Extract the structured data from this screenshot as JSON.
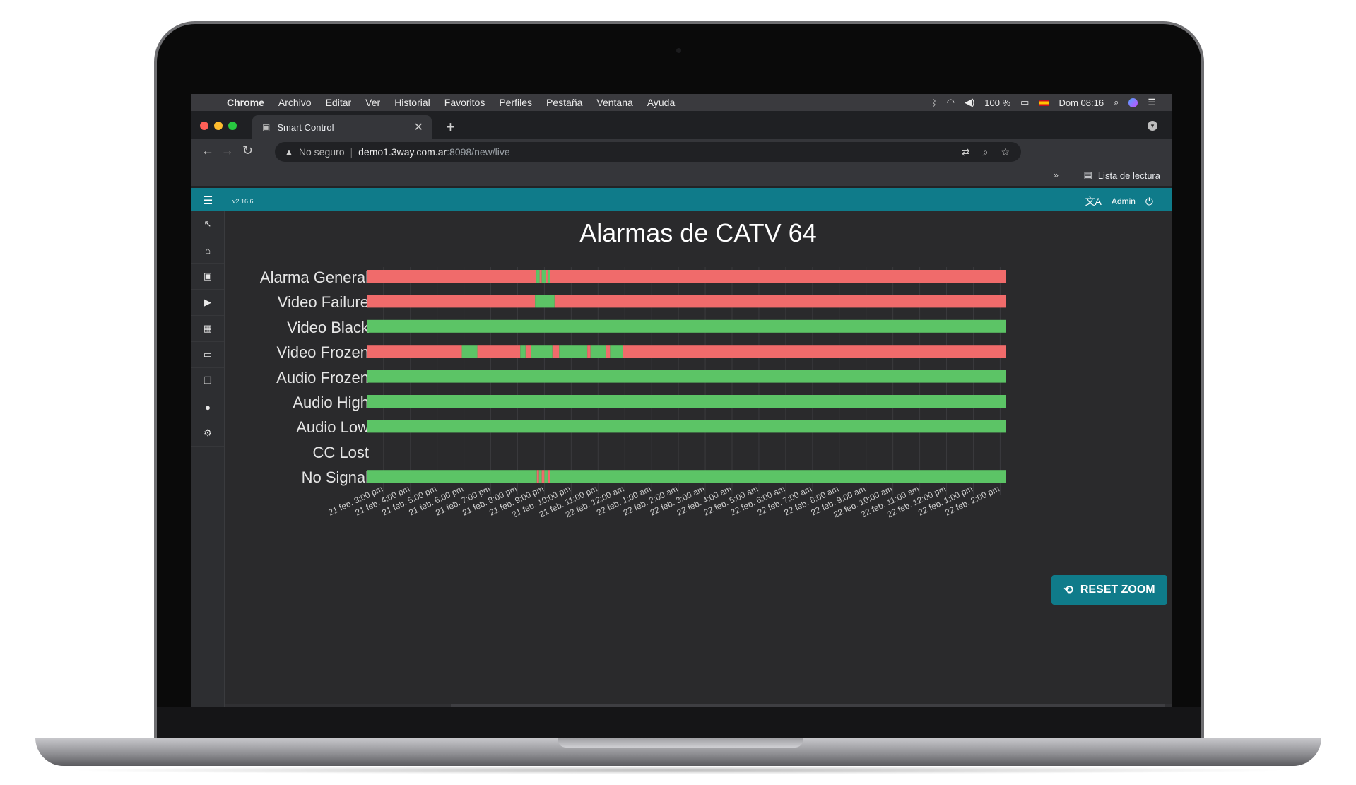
{
  "menubar": {
    "apple_icon": "apple-logo-icon",
    "items": [
      "Chrome",
      "Archivo",
      "Editar",
      "Ver",
      "Historial",
      "Favoritos",
      "Perfiles",
      "Pestaña",
      "Ventana",
      "Ayuda"
    ],
    "battery": "100 %",
    "clock": "Dom 08:16"
  },
  "browser": {
    "tab_title": "Smart Control",
    "url_warning": "No seguro",
    "url_host": "demo1.3way.com.ar",
    "url_path": ":8098/new/live",
    "reading_list": "Lista de lectura",
    "bookmarks_more": "»"
  },
  "app": {
    "version": "v2.16.6",
    "user": "Admin",
    "accent": "#0f7b8a"
  },
  "chart_data": {
    "type": "timeline",
    "title": "Alarmas de CATV 64",
    "colors": {
      "alarm": "#f06b6b",
      "ok": "#5cc466"
    },
    "x_ticks": [
      "21 feb. 3:00 pm",
      "21 feb. 4:00 pm",
      "21 feb. 5:00 pm",
      "21 feb. 6:00 pm",
      "21 feb. 7:00 pm",
      "21 feb. 8:00 pm",
      "21 feb. 9:00 pm",
      "21 feb. 10:00 pm",
      "21 feb. 11:00 pm",
      "22 feb. 12:00 am",
      "22 feb. 1:00 am",
      "22 feb. 2:00 am",
      "22 feb. 3:00 am",
      "22 feb. 4:00 am",
      "22 feb. 5:00 am",
      "22 feb. 6:00 am",
      "22 feb. 7:00 am",
      "22 feb. 8:00 am",
      "22 feb. 9:00 am",
      "22 feb. 10:00 am",
      "22 feb. 11:00 am",
      "22 feb. 12:00 pm",
      "22 feb. 1:00 pm",
      "22 feb. 2:00 pm"
    ],
    "x_range_hours": [
      -0.6,
      23.2
    ],
    "rows": [
      {
        "name": "Alarma General",
        "segments": [
          [
            -0.6,
            5.7,
            "alarm"
          ],
          [
            5.7,
            5.82,
            "ok"
          ],
          [
            5.82,
            5.9,
            "alarm"
          ],
          [
            5.9,
            6.05,
            "ok"
          ],
          [
            6.05,
            6.12,
            "alarm"
          ],
          [
            6.12,
            6.22,
            "ok"
          ],
          [
            6.22,
            23.2,
            "alarm"
          ]
        ]
      },
      {
        "name": "Video Failure",
        "segments": [
          [
            -0.6,
            5.65,
            "alarm"
          ],
          [
            5.65,
            6.38,
            "ok"
          ],
          [
            6.38,
            23.2,
            "alarm"
          ]
        ]
      },
      {
        "name": "Video Black",
        "segments": [
          [
            -0.6,
            23.2,
            "ok"
          ]
        ]
      },
      {
        "name": "Video Frozen",
        "segments": [
          [
            -0.6,
            2.92,
            "alarm"
          ],
          [
            2.92,
            3.5,
            "ok"
          ],
          [
            3.5,
            5.1,
            "alarm"
          ],
          [
            5.1,
            5.3,
            "ok"
          ],
          [
            5.3,
            5.5,
            "alarm"
          ],
          [
            5.5,
            6.3,
            "ok"
          ],
          [
            6.3,
            6.55,
            "alarm"
          ],
          [
            6.55,
            7.6,
            "ok"
          ],
          [
            7.6,
            7.72,
            "alarm"
          ],
          [
            7.72,
            8.3,
            "ok"
          ],
          [
            8.3,
            8.45,
            "alarm"
          ],
          [
            8.45,
            8.93,
            "ok"
          ],
          [
            8.93,
            23.2,
            "alarm"
          ]
        ]
      },
      {
        "name": "Audio Frozen",
        "segments": [
          [
            -0.6,
            23.2,
            "ok"
          ]
        ]
      },
      {
        "name": "Audio High",
        "segments": [
          [
            -0.6,
            23.2,
            "ok"
          ]
        ]
      },
      {
        "name": "Audio Low",
        "segments": [
          [
            -0.6,
            23.2,
            "ok"
          ]
        ]
      },
      {
        "name": "CC Lost",
        "segments": []
      },
      {
        "name": "No Signal",
        "segments": [
          [
            -0.6,
            5.72,
            "ok"
          ],
          [
            5.72,
            5.8,
            "alarm"
          ],
          [
            5.8,
            5.9,
            "ok"
          ],
          [
            5.9,
            6.0,
            "alarm"
          ],
          [
            6.0,
            6.12,
            "ok"
          ],
          [
            6.12,
            6.22,
            "alarm"
          ],
          [
            6.22,
            23.2,
            "ok"
          ]
        ]
      }
    ]
  },
  "reset_zoom": "RESET ZOOM"
}
